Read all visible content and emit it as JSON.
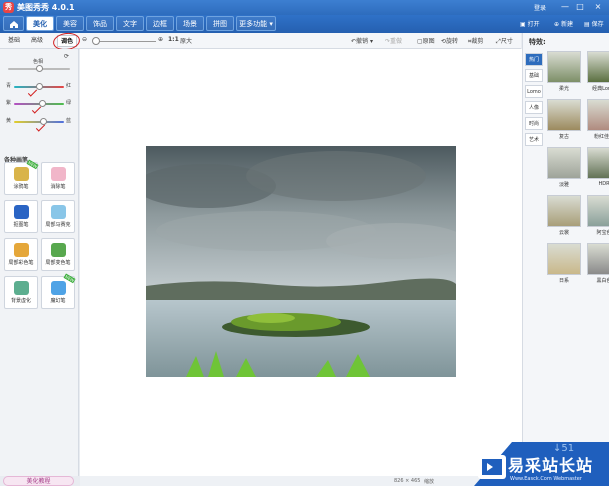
{
  "window": {
    "title": "美图秀秀 4.0.1",
    "logo": "秀",
    "login": "登录",
    "min_icon": "—",
    "max_icon": "□",
    "close_icon": "×"
  },
  "nav": {
    "tabs": [
      "美化",
      "美容",
      "饰品",
      "文字",
      "边框",
      "场景",
      "拼图",
      "更多功能 ▾"
    ],
    "active": "美化",
    "actions": [
      "打开",
      "新建",
      "保存"
    ]
  },
  "subtabs": {
    "items": [
      "基础",
      "高级",
      "调色"
    ],
    "active": "调色"
  },
  "toolbar": {
    "zoom_ratio": "1:1",
    "zoom_label": "原大",
    "undo": "撤销",
    "redo": "重做",
    "original": "原图",
    "rotate": "旋转",
    "crop": "裁剪",
    "size": "尺寸"
  },
  "adjust": {
    "brightness_label": "色相",
    "brightness_level": 0.5,
    "sliders": [
      {
        "left": "青",
        "right": "红",
        "level": 0.5,
        "color_left": "#22b5c4",
        "color_right": "#e84545"
      },
      {
        "left": "紫",
        "right": "绿",
        "level": 0.55,
        "color_left": "#b54fc4",
        "color_right": "#4cbf4c"
      },
      {
        "left": "黄",
        "right": "蓝",
        "level": 0.58,
        "color_left": "#e3cf2b",
        "color_right": "#4f6fe0"
      }
    ]
  },
  "brushes": {
    "title": "各种画笔",
    "items": [
      {
        "label": "涂鸦笔",
        "badge": "NEW",
        "icon": "doodle-pen-icon",
        "color": "#d9b44a"
      },
      {
        "label": "消除笔",
        "badge": "",
        "icon": "eraser-icon",
        "color": "#f1b6c9"
      },
      {
        "label": "抠图笔",
        "badge": "",
        "icon": "cutout-pen-icon",
        "color": "#2a64c4"
      },
      {
        "label": "局部马赛克",
        "badge": "",
        "icon": "mosaic-icon",
        "color": "#89c6e8"
      },
      {
        "label": "局部彩色笔",
        "badge": "",
        "icon": "color-brush-icon",
        "color": "#e5a73a"
      },
      {
        "label": "局部变色笔",
        "badge": "",
        "icon": "change-color-icon",
        "color": "#58a84e"
      },
      {
        "label": "背景虚化",
        "badge": "",
        "icon": "blur-icon",
        "color": "#5cae8f"
      },
      {
        "label": "魔幻笔",
        "badge": "NEW",
        "icon": "magic-pen-icon",
        "color": "#4fa3e6"
      }
    ]
  },
  "tutorial": "美化教程",
  "effects": {
    "title": "特效:",
    "categories": [
      "热门",
      "基础",
      "Lomo",
      "人像",
      "时尚",
      "艺术"
    ],
    "active": "热门",
    "items": [
      {
        "label": "柔光",
        "color": "#7d8f68"
      },
      {
        "label": "经典Lomo",
        "color": "#5b7041"
      },
      {
        "label": "复古",
        "color": "#9c8a5e"
      },
      {
        "label": "粉红佳人",
        "color": "#b08b7f"
      },
      {
        "label": "淡雅",
        "color": "#9ea399"
      },
      {
        "label": "HDR",
        "color": "#627256"
      },
      {
        "label": "云裳",
        "color": "#a89e79"
      },
      {
        "label": "阿宝色",
        "color": "#8aa09a"
      },
      {
        "label": "日系",
        "color": "#c9b88a"
      },
      {
        "label": "黑白色",
        "color": "#8a8a8a"
      }
    ]
  },
  "status": {
    "dimensions": "826 × 465",
    "zoom_text": "缩放"
  },
  "watermark": {
    "main": "易采站长站",
    "sub": "Www.Easck.Com Webmaster",
    "light": "↓51"
  }
}
